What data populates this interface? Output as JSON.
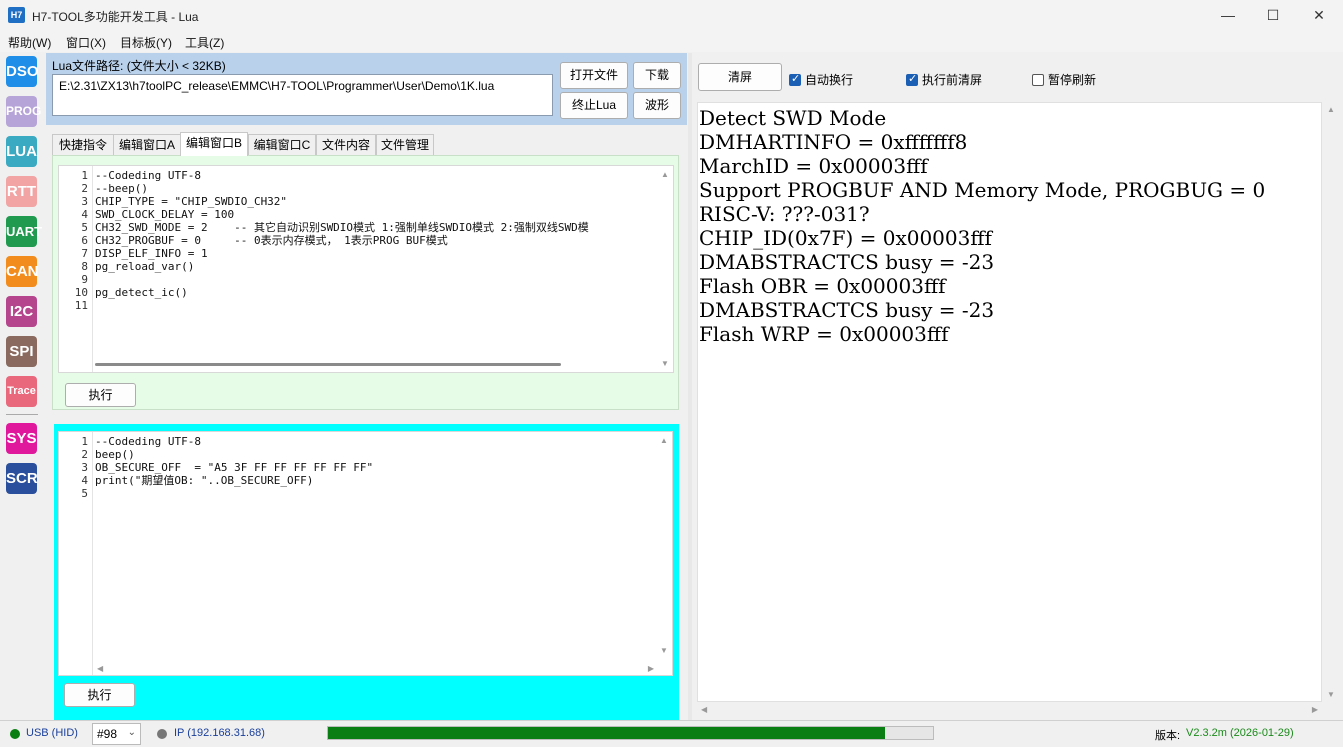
{
  "window": {
    "app_icon": "H7",
    "title": "H7-TOOL多功能开发工具 - Lua",
    "minimize_icon": "—",
    "maximize_icon": "☐",
    "close_icon": "✕"
  },
  "menu": [
    "帮助(W)",
    "窗口(X)",
    "目标板(Y)",
    "工具(Z)"
  ],
  "sidebar": {
    "items": [
      {
        "label": "DSO",
        "color": "#1e8ee8"
      },
      {
        "label": "PROG",
        "color": "#b6a4d8"
      },
      {
        "label": "LUA",
        "color": "#3aa9c2"
      },
      {
        "label": "RTT",
        "color": "#f2a3a3"
      },
      {
        "label": "UART",
        "color": "#1f9a4f"
      },
      {
        "label": "CAN",
        "color": "#f28c1c"
      },
      {
        "label": "I2C",
        "color": "#b5458d"
      },
      {
        "label": "SPI",
        "color": "#8a6a5f"
      },
      {
        "label": "Trace",
        "color": "#e9687c"
      },
      {
        "label": "SYS",
        "color": "#e0199c"
      },
      {
        "label": "SCR",
        "color": "#2a4f9c"
      }
    ]
  },
  "lua_file": {
    "path_label": "Lua文件路径: (文件大小 < 32KB)",
    "path_value": "E:\\2.31\\ZX13\\h7toolPC_release\\EMMC\\H7-TOOL\\Programmer\\User\\Demo\\1K.lua",
    "open_button": "打开文件",
    "download_button": "下载",
    "stop_button": "终止Lua",
    "wave_button": "波形"
  },
  "tabs": [
    "快捷指令",
    "编辑窗口A",
    "编辑窗口B",
    "编辑窗口C",
    "文件内容",
    "文件管理"
  ],
  "active_tab": "编辑窗口B",
  "editor_top": {
    "line_numbers": [
      "1",
      "2",
      "3",
      "4",
      "5",
      "6",
      "7",
      "8",
      "9",
      "10",
      "11"
    ],
    "lines": [
      "--Codeding UTF-8",
      "--beep()",
      "CHIP_TYPE = \"CHIP_SWDIO_CH32\"",
      "SWD_CLOCK_DELAY = 100",
      "CH32_SWD_MODE = 2    -- 其它自动识别SWDIO模式 1:强制单线SWDIO模式 2:强制双线SWD模",
      "CH32_PROGBUF = 0     -- 0表示内存模式， 1表示PROG BUF模式",
      "DISP_ELF_INFO = 1",
      "pg_reload_var()",
      "",
      "pg_detect_ic()",
      ""
    ],
    "run_button": "执行"
  },
  "editor_bottom": {
    "line_numbers": [
      "1",
      "2",
      "3",
      "4",
      "5"
    ],
    "lines": [
      "--Codeding UTF-8",
      "beep()",
      "OB_SECURE_OFF  = \"A5 3F FF FF FF FF FF FF\"",
      "print(\"期望值OB: \"..OB_SECURE_OFF)",
      ""
    ],
    "run_button": "执行"
  },
  "output_toolbar": {
    "clear_button": "清屏",
    "auto_wrap": {
      "label": "自动换行",
      "checked": true
    },
    "clear_before_run": {
      "label": "执行前清屏",
      "checked": true
    },
    "pause_refresh": {
      "label": "暂停刷新",
      "checked": false
    }
  },
  "output": {
    "lines": [
      "Detect SWD Mode",
      "DMHARTINFO = 0xfffffff8",
      "MarchID = 0x00003fff",
      "Support PROGBUF AND Memory Mode, PROGBUG = 0",
      "RISC-V: ???-031?",
      "CHIP_ID(0x7F) = 0x00003fff",
      "DMABSTRACTCS busy = -23",
      "Flash OBR = 0x00003fff",
      "DMABSTRACTCS busy = -23",
      "Flash WRP = 0x00003fff"
    ]
  },
  "status": {
    "usb_label": "USB (HID)",
    "usb_color": "#0a7e12",
    "device_combo": "#98",
    "ip_label": "IP (192.168.31.68)",
    "ip_color": "#777777",
    "progress_percent": 92,
    "progress_color": "#0a7e12",
    "version_label": "版本:",
    "version_value": "V2.3.2m (2026-01-29)"
  }
}
